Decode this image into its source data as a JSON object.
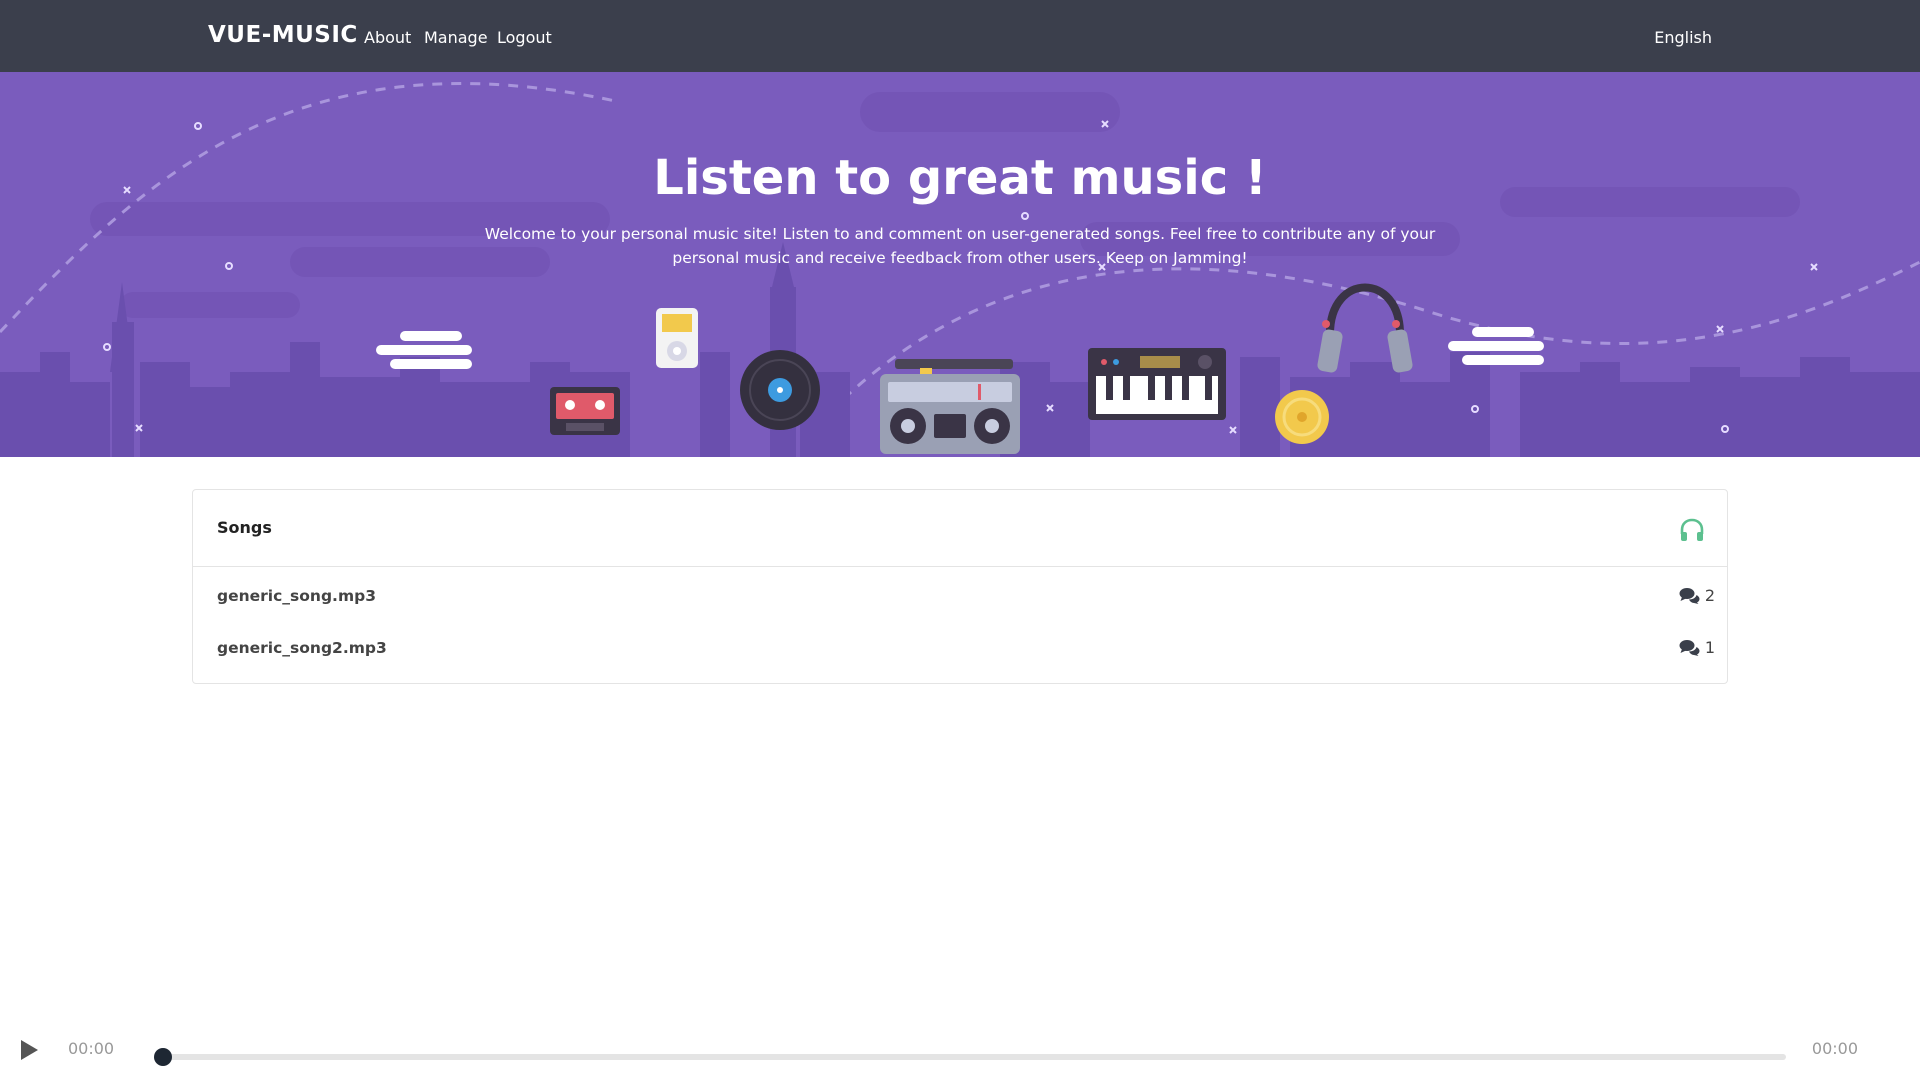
{
  "header": {
    "brand": "VUE-MUSIC",
    "nav": {
      "about": "About",
      "manage": "Manage",
      "logout": "Logout"
    },
    "language": "English"
  },
  "hero": {
    "title": "Listen to great music !",
    "subtitle": "Welcome to your personal music site! Listen to and comment on user-generated songs. Feel free to contribute any of your personal music and receive feedback from other users. Keep on Jamming!",
    "background_color": "#7a5cbd"
  },
  "songs_panel": {
    "title": "Songs",
    "header_icon": "headphones-icon",
    "accent_color": "#5cc08f",
    "items": [
      {
        "name": "generic_song.mp3",
        "comments": "2"
      },
      {
        "name": "generic_song2.mp3",
        "comments": "1"
      }
    ]
  },
  "player": {
    "current_time": "00:00",
    "duration": "00:00",
    "progress": 0
  },
  "colors": {
    "topbar": "#3b3f4c",
    "hero": "#7a5cbd",
    "accent": "#5cc08f"
  }
}
